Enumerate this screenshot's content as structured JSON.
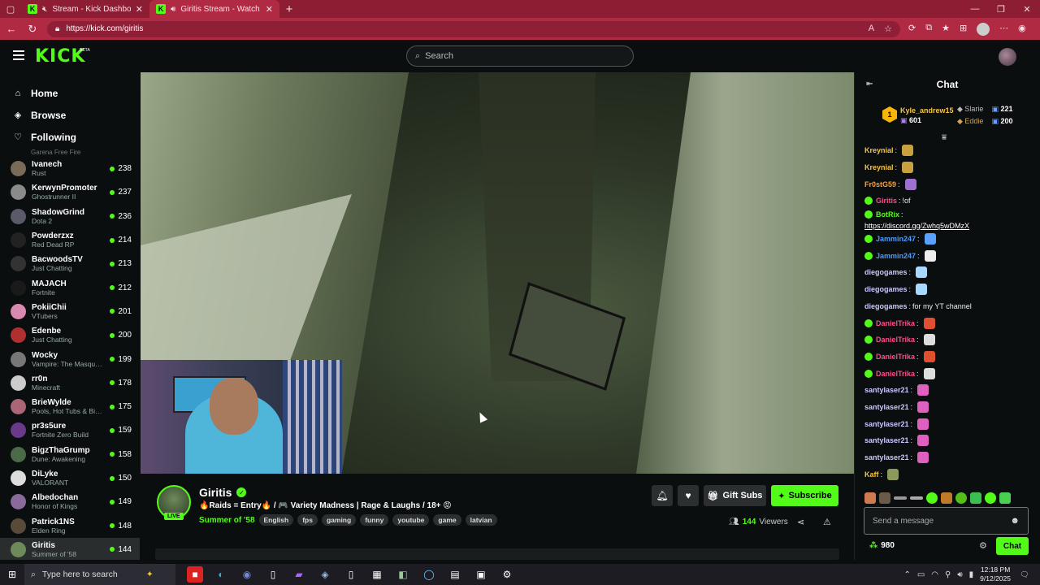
{
  "browser": {
    "tabs": [
      {
        "title": "Stream - Kick Dashboard",
        "active": false
      },
      {
        "title": "Giritis Stream - Watch Live o",
        "active": true
      }
    ],
    "url": "https://kick.com/giritis"
  },
  "header": {
    "logo": "KICK",
    "logo_badge": "BETA",
    "search_placeholder": "Search"
  },
  "sidebar": {
    "nav": [
      {
        "label": "Home",
        "icon": "home-icon"
      },
      {
        "label": "Browse",
        "icon": "compass-icon"
      },
      {
        "label": "Following",
        "icon": "heart-icon"
      }
    ],
    "clipped_category": "Garena Free Fire",
    "channels": [
      {
        "name": "Ivanech",
        "category": "Rust",
        "viewers": "238",
        "color": "#7a6a5a"
      },
      {
        "name": "KerwynPromoter",
        "category": "Ghostrunner II",
        "viewers": "237",
        "color": "#8a8a8a"
      },
      {
        "name": "ShadowGrind",
        "category": "Dota 2",
        "viewers": "236",
        "color": "#5a5a6a"
      },
      {
        "name": "Powderzxz",
        "category": "Red Dead RP",
        "viewers": "214",
        "color": "#222"
      },
      {
        "name": "BacwoodsTV",
        "category": "Just Chatting",
        "viewers": "213",
        "color": "#333"
      },
      {
        "name": "MAJACH",
        "category": "Fortnite",
        "viewers": "212",
        "color": "#1a1a1a"
      },
      {
        "name": "PokiiChii",
        "category": "VTubers",
        "viewers": "201",
        "color": "#d88ab0"
      },
      {
        "name": "Edenbe",
        "category": "Just Chatting",
        "viewers": "200",
        "color": "#b03030"
      },
      {
        "name": "Wocky",
        "category": "Vampire: The Masquer...",
        "viewers": "199",
        "color": "#777"
      },
      {
        "name": "rr0n",
        "category": "Minecraft",
        "viewers": "178",
        "color": "#ccc"
      },
      {
        "name": "BrieWylde",
        "category": "Pools, Hot Tubs & Bikinis",
        "viewers": "175",
        "color": "#aa6677"
      },
      {
        "name": "pr3s5ure",
        "category": "Fortnite Zero Build",
        "viewers": "159",
        "color": "#6a3a8a"
      },
      {
        "name": "BigzThaGrump",
        "category": "Dune: Awakening",
        "viewers": "158",
        "color": "#4a6a4a"
      },
      {
        "name": "DiLyke",
        "category": "VALORANT",
        "viewers": "150",
        "color": "#ddd"
      },
      {
        "name": "Albedochan",
        "category": "Honor of Kings",
        "viewers": "149",
        "color": "#8a6a9a"
      },
      {
        "name": "Patrick1NS",
        "category": "Elden Ring",
        "viewers": "148",
        "color": "#5a4a3a"
      },
      {
        "name": "Giritis",
        "category": "Summer of '58",
        "viewers": "144",
        "color": "#6f8a5a",
        "active": true
      }
    ]
  },
  "stream": {
    "streamer": "Giritis",
    "live_label": "LIVE",
    "title": "🔥Raids = Entry🔥 / 🎮 Variety Madness | Rage & Laughs / 18+ 😡",
    "category": "Summer of '58",
    "tags": [
      "English",
      "fps",
      "gaming",
      "funny",
      "youtube",
      "game",
      "latvian"
    ],
    "gift_subs_label": "Gift Subs",
    "subscribe_label": "Subscribe",
    "viewers_count": "144",
    "viewers_label": "Viewers"
  },
  "chat": {
    "title": "Chat",
    "leaderboard": {
      "first": {
        "rank": "1",
        "name": "Kyle_andrew15",
        "count": "601"
      },
      "second": {
        "name": "Slarie",
        "count": "221"
      },
      "third": {
        "name": "Eddie",
        "count": "200"
      }
    },
    "messages": [
      {
        "user": "Kreynial",
        "text": "",
        "color": "#f5c542",
        "emote": "#c9a040"
      },
      {
        "user": "Kreynial",
        "text": "",
        "color": "#f5c542",
        "emote": "#c9a040"
      },
      {
        "user": "Fr0stG59",
        "text": "",
        "color": "#f7a040",
        "emote": "#a070d0"
      },
      {
        "user": "Giritis",
        "text": "!of",
        "color": "#ff4a8a",
        "emote": ""
      },
      {
        "user": "BotRix",
        "text": "https://discord.gg/Zwhq5wDMzX",
        "color": "#53fc18",
        "emote": ""
      },
      {
        "user": "Jammin247",
        "text": "",
        "color": "#4a9aff",
        "emote": "#5aa0ff"
      },
      {
        "user": "Jammin247",
        "text": "",
        "color": "#4a9aff",
        "emote": "#eee"
      },
      {
        "user": "diegogames",
        "text": "",
        "color": "#c9c9ff",
        "emote": "#a8d8ff"
      },
      {
        "user": "diegogames",
        "text": "",
        "color": "#c9c9ff",
        "emote": "#a8d8ff"
      },
      {
        "user": "diegogames",
        "text": "for my YT channel",
        "color": "#c9c9ff",
        "emote": ""
      },
      {
        "user": "DanielTrika",
        "text": "",
        "color": "#ff4a8a",
        "emote": "#e05030"
      },
      {
        "user": "DanielTrika",
        "text": "",
        "color": "#ff4a8a",
        "emote": "#ddd"
      },
      {
        "user": "DanielTrika",
        "text": "",
        "color": "#ff4a8a",
        "emote": "#e05030"
      },
      {
        "user": "DanielTrika",
        "text": "",
        "color": "#ff4a8a",
        "emote": "#ddd"
      },
      {
        "user": "santylaser21",
        "text": "",
        "color": "#c9c9ff",
        "emote": "#e060c0"
      },
      {
        "user": "santylaser21",
        "text": "",
        "color": "#c9c9ff",
        "emote": "#e060c0"
      },
      {
        "user": "santylaser21",
        "text": "",
        "color": "#c9c9ff",
        "emote": "#e060c0"
      },
      {
        "user": "santylaser21",
        "text": "",
        "color": "#c9c9ff",
        "emote": "#e060c0"
      },
      {
        "user": "santylaser21",
        "text": "",
        "color": "#c9c9ff",
        "emote": "#e060c0"
      },
      {
        "user": "Kaff",
        "text": "",
        "color": "#f5c542",
        "emote": "#8a9a5a"
      }
    ],
    "input_placeholder": "Send a message",
    "points": "980",
    "send_label": "Chat"
  },
  "taskbar": {
    "search_placeholder": "Type here to search",
    "time": "12:18 PM",
    "date": "9/12/2025"
  },
  "colors": {
    "accent": "#53fc18",
    "browser_frame": "#b02a44"
  }
}
